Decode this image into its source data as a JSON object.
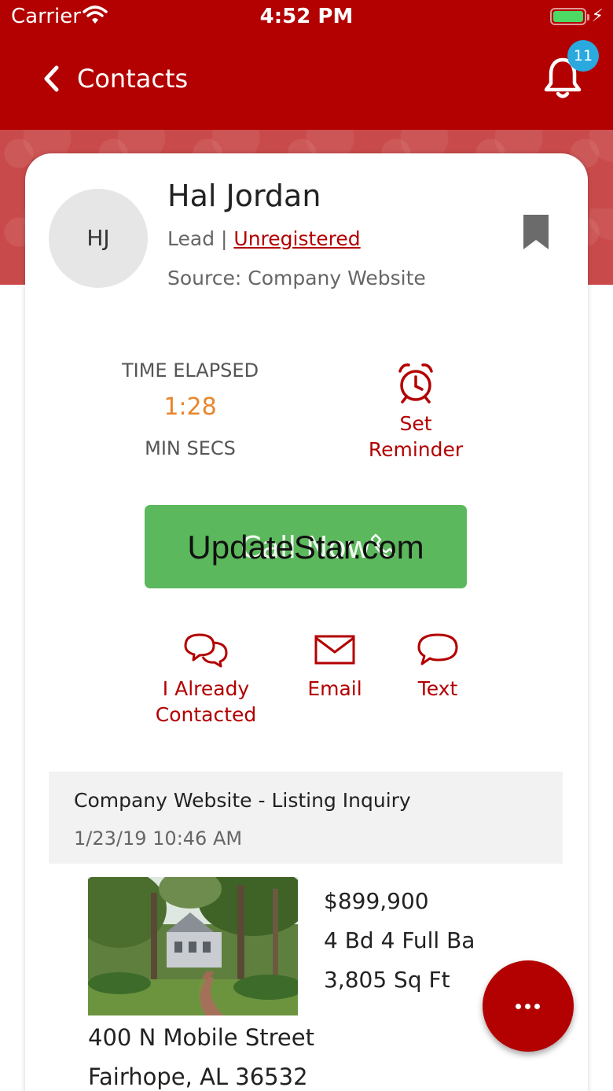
{
  "status_bar": {
    "carrier": "Carrier",
    "time": "4:52 PM"
  },
  "nav": {
    "back_label": "Contacts",
    "notification_count": "11"
  },
  "contact": {
    "initials": "HJ",
    "name": "Hal Jordan",
    "type": "Lead",
    "separator": "|",
    "registration": "Unregistered",
    "source": "Source: Company Website"
  },
  "timer": {
    "label": "TIME ELAPSED",
    "value": "1:28",
    "units": "MIN  SECS"
  },
  "reminder": {
    "line1": "Set",
    "line2": "Reminder"
  },
  "call_button": {
    "label": "Call Now",
    "watermark": "UpdateStar.com"
  },
  "actions": {
    "contacted_line1": "I Already",
    "contacted_line2": "Contacted",
    "email": "Email",
    "text": "Text"
  },
  "inquiry": {
    "title": "Company Website - Listing Inquiry",
    "date": "1/23/19 10:46 AM"
  },
  "listing": {
    "price": "$899,900",
    "beds_baths": "4 Bd 4 Full Ba",
    "sqft": "3,805 Sq Ft",
    "address_line1": "400 N Mobile Street",
    "address_line2": "Fairhope, AL 36532"
  },
  "colors": {
    "brand": "#b30000",
    "call_green": "#5cb85c",
    "timer_orange": "#e8862b",
    "badge_blue": "#2aa9df"
  },
  "icons": [
    "back-chevron-icon",
    "bell-icon",
    "bookmark-icon",
    "alarm-clock-icon",
    "phone-icon",
    "chat-bubbles-icon",
    "envelope-icon",
    "speech-bubble-icon",
    "more-dots-icon"
  ]
}
